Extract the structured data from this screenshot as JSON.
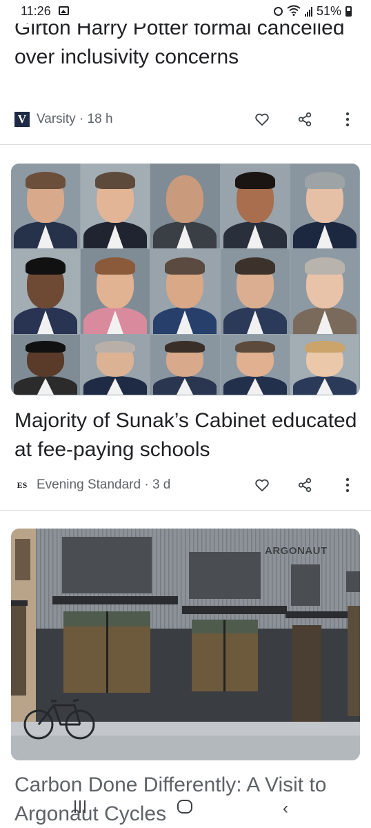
{
  "status_bar": {
    "time": "11:26",
    "battery": "51%"
  },
  "articles": [
    {
      "headline": "Girton Harry Potter formal cancelled over inclusivity concerns",
      "source_logo": "V",
      "source": "Varsity",
      "age": "18 h",
      "source_line": "Varsity · 18 h"
    },
    {
      "headline": "Majority of Sunak’s Cabinet educated at fee-paying schools",
      "source_logo": "ES",
      "source": "Evening Standard",
      "age": "3 d",
      "source_line": "Evening Standard · 3 d"
    },
    {
      "headline": "Carbon Done Differently: A Visit to Argonaut Cycles",
      "building_sign": "ARGONAUT"
    }
  ],
  "icons": {
    "like": "heart-icon",
    "share": "share-icon",
    "more": "more-vertical-icon"
  },
  "nav_bar": {
    "recent_apps": "recent-apps-icon",
    "home": "home-icon",
    "back": "back-icon"
  },
  "colors": {
    "text_primary": "#202124",
    "text_secondary": "#5f6368",
    "divider": "#dadce0",
    "varsity_logo": "#1f2a44"
  }
}
